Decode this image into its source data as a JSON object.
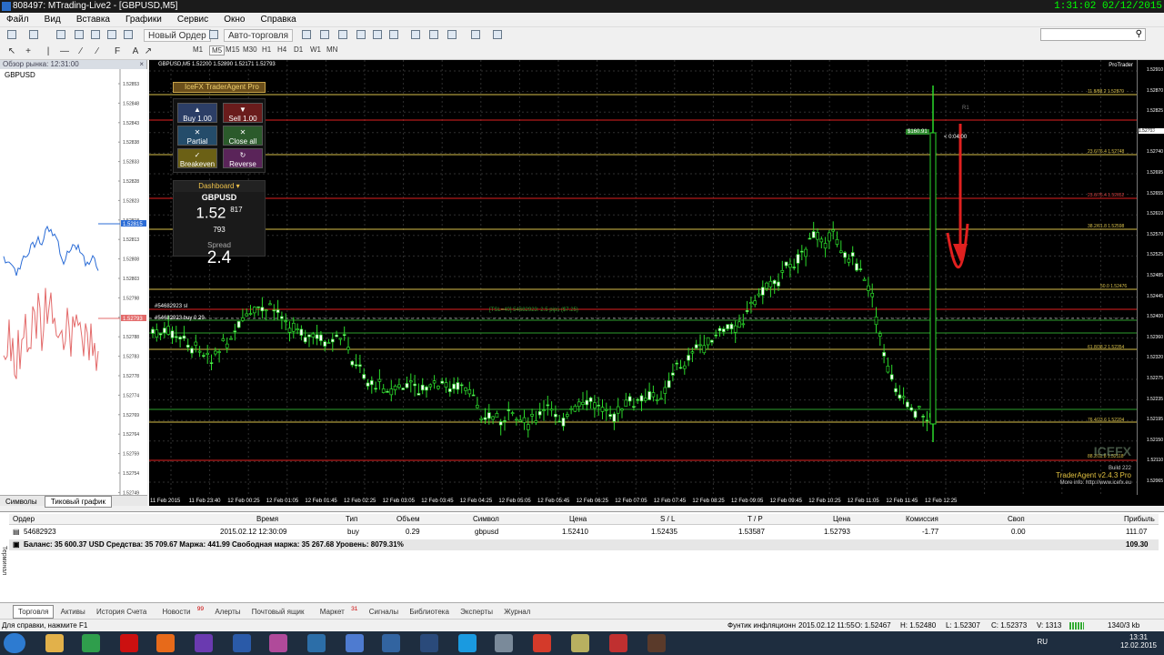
{
  "window": {
    "title": "808497: MTrading-Live2 - [GBPUSD,M5]",
    "clock": "1:31:02  02/12/2015"
  },
  "menu": [
    "Файл",
    "Вид",
    "Вставка",
    "Графики",
    "Сервис",
    "Окно",
    "Справка"
  ],
  "toolbar": {
    "new_order": "Новый Ордер",
    "autotrading": "Авто-торговля"
  },
  "timeframes": [
    "M1",
    "M5",
    "M15",
    "M30",
    "H1",
    "H4",
    "D1",
    "W1",
    "MN"
  ],
  "active_timeframe": "M5",
  "market_watch": {
    "title": "Обзор рынка: 12:31:00",
    "symbol": "GBPUSD",
    "tabs": [
      "Символы",
      "Тиковый график"
    ],
    "active_tab": "Тиковый график",
    "price_ticks": [
      "1.52853",
      "1.52848",
      "1.52843",
      "1.52838",
      "1.52833",
      "1.52828",
      "1.52823",
      "1.52818",
      "1.52813",
      "1.52808",
      "1.52803",
      "1.52798",
      "1.52793",
      "1.52788",
      "1.52783",
      "1.52778",
      "1.52774",
      "1.52769",
      "1.52764",
      "1.52759",
      "1.52754",
      "1.52749"
    ],
    "bid_tag": "1.52815",
    "ask_tag": "1.52793"
  },
  "chart": {
    "header": "GBPUSD,M5  1.52200 1.52890 1.52171 1.52793",
    "protrader": "ProTrader",
    "price_ticks": [
      "1.52910",
      "1.52870",
      "1.52825",
      "1.52780",
      "1.52740",
      "1.52695",
      "1.52655",
      "1.52610",
      "1.52570",
      "1.52525",
      "1.52485",
      "1.52445",
      "1.52400",
      "1.52360",
      "1.52320",
      "1.52275",
      "1.52235",
      "1.52195",
      "1.52150",
      "1.52110",
      "1.52065"
    ],
    "current_price_tag": "1.52793",
    "time_ticks": [
      "11 Feb 2015",
      "11 Feb 23:40",
      "12 Feb 00:25",
      "12 Feb 01:05",
      "12 Feb 01:45",
      "12 Feb 02:25",
      "12 Feb 03:05",
      "12 Feb 03:45",
      "12 Feb 04:25",
      "12 Feb 05:05",
      "12 Feb 05:45",
      "12 Feb 06:25",
      "12 Feb 07:05",
      "12 Feb 07:45",
      "12 Feb 08:25",
      "12 Feb 09:05",
      "12 Feb 09:45",
      "12 Feb 10:25",
      "12 Feb 11:05",
      "12 Feb 11:45",
      "12 Feb 12:25"
    ],
    "fib_labels": [
      "11.8/88.2 1.52870",
      "23.6/76.4 1.52748",
      "23.6/76.4 1.52652",
      "38.2/61.8 1.52598",
      "50.0 1.52476",
      "61.8/38.2 1.52354",
      "76.4/23.6 1.52204",
      "88.2/11.8 1.52118"
    ],
    "order_label_1": "#54682923 sl",
    "order_label_2": "#54682923 buy 0.29",
    "tsl_label": "[TSL=40] 54682923: 2.5 pips ($7.25)",
    "profit_tag": "$160.91",
    "timer": "< 0:04:00",
    "r1_label": "R1",
    "watermark": "ICEFX",
    "build": "Build 222",
    "traderagent": "TraderAgent v2.4.3 Pro",
    "more_info": "More info: http://www.icefx.eu"
  },
  "agent": {
    "title": "IceFX TraderAgent Pro",
    "buy": "Buy 1.00",
    "sell": "Sell 1.00",
    "partial": "Partial",
    "close_all": "Close all",
    "breakeven": "Breakeven",
    "reverse": "Reverse",
    "dashboard": "Dashboard",
    "symbol": "GBPUSD",
    "price_main": "1.52",
    "price_frac": "817",
    "price_frac2": "793",
    "spread_label": "Spread",
    "spread": "2.4"
  },
  "terminal": {
    "headers": [
      "Ордер",
      "Время",
      "Тип",
      "Объем",
      "Символ",
      "Цена",
      "S / L",
      "T / P",
      "Цена",
      "Комиссия",
      "Своп",
      "Прибыль"
    ],
    "row": [
      "54682923",
      "2015.02.12 12:30:09",
      "buy",
      "0.29",
      "gbpusd",
      "1.52410",
      "1.52435",
      "1.53587",
      "1.52793",
      "-1.77",
      "0.00",
      "111.07"
    ],
    "balance": "Баланс: 35 600.37 USD  Средства: 35 709.67  Маржа: 441.99  Свободная маржа: 35 267.68  Уровень: 8079.31%",
    "balance_profit": "109.30",
    "tabs": [
      "Торговля",
      "Активы",
      "История Счета",
      "Новости",
      "Алерты",
      "Почтовый ящик",
      "Маркет",
      "Сигналы",
      "Библиотека",
      "Эксперты",
      "Журнал"
    ],
    "news_badge": "99",
    "market_badge": "31",
    "side_label": "Терминал"
  },
  "status": {
    "help": "Для справки, нажмите F1",
    "profile": "Фунтик инфляционн",
    "datetime": "2015.02.12 11:55",
    "open": "O: 1.52467",
    "high": "H: 1.52480",
    "low": "L: 1.52307",
    "close": "C: 1.52373",
    "volume": "V: 1313",
    "traffic": "1340/3 kb"
  },
  "taskbar": {
    "lang": "RU",
    "time": "13:31",
    "date": "12.02.2015"
  }
}
